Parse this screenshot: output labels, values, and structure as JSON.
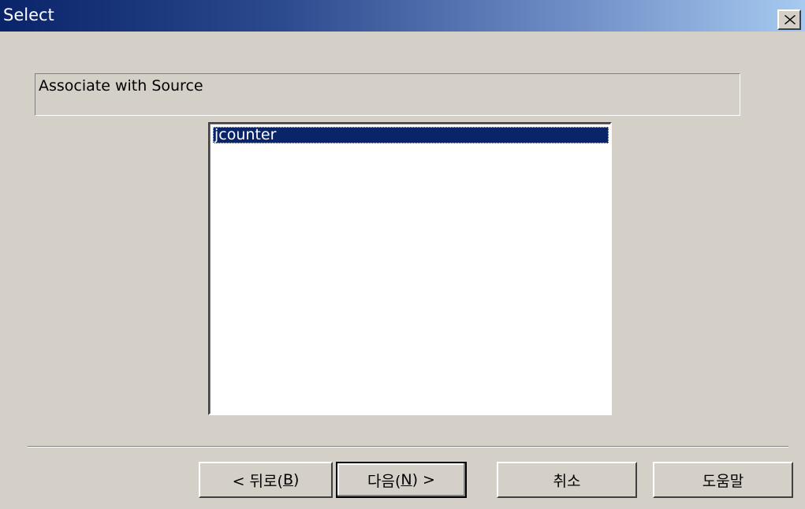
{
  "window": {
    "title": "Select",
    "close_icon": "close-icon"
  },
  "header": {
    "text": "Associate with Source"
  },
  "list": {
    "items": [
      "jcounter"
    ],
    "selected_index": 0
  },
  "buttons": {
    "back": {
      "prefix": "< 뒤로(",
      "mnemonic": "B",
      "suffix": ")"
    },
    "next": {
      "prefix": "다음(",
      "mnemonic": "N",
      "suffix": ") >"
    },
    "cancel": "취소",
    "help": "도움말"
  },
  "colors": {
    "title_gradient_start": "#0a246a",
    "title_gradient_end": "#a6caf0",
    "selection": "#0a246a",
    "face": "#d4d0c8"
  }
}
